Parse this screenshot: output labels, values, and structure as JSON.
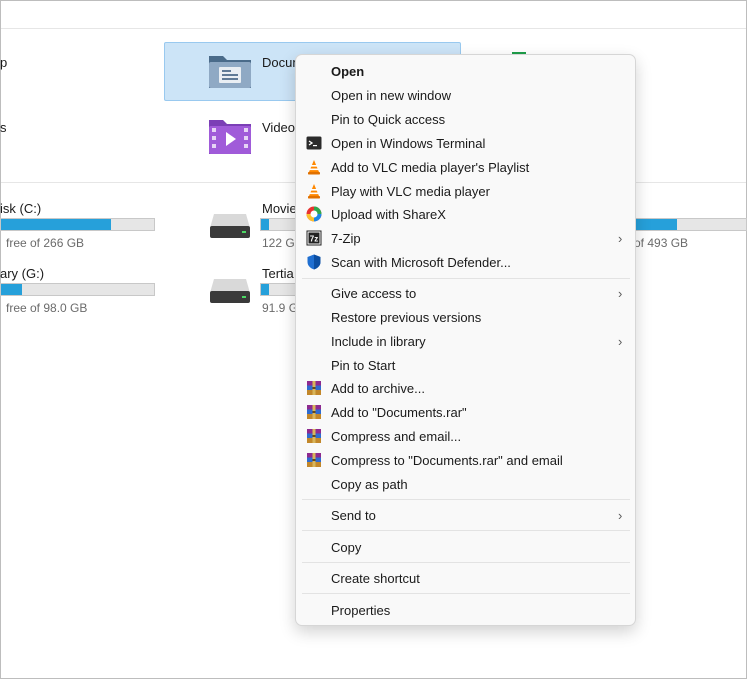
{
  "background_items": {
    "row1": {
      "left_label_fragment": "p",
      "selected_folder_label": "Docum"
    },
    "row2": {
      "left_label_fragment": "s",
      "videos_label": "Video"
    },
    "drives": [
      {
        "name_fragment": "isk (C:)",
        "free_text": "free of 266 GB",
        "used_fraction": 0.72
      },
      {
        "name_fragment": "Movie",
        "free_text": "122 G",
        "used_fraction": 0.2
      },
      {
        "name_fragment": "",
        "free_text": "of 493 GB",
        "used_fraction": 0.45
      },
      {
        "name_fragment": "ary (G:)",
        "free_text": "free of 98.0 GB",
        "used_fraction": 0.14
      },
      {
        "name_fragment": "Tertia",
        "free_text": "91.9 G",
        "used_fraction": 0.2
      }
    ]
  },
  "context_menu": {
    "items": [
      {
        "label": "Open",
        "icon": "",
        "bold": true
      },
      {
        "label": "Open in new window",
        "icon": ""
      },
      {
        "label": "Pin to Quick access",
        "icon": ""
      },
      {
        "label": "Open in Windows Terminal",
        "icon": "terminal-icon"
      },
      {
        "label": "Add to VLC media player's Playlist",
        "icon": "vlc-icon"
      },
      {
        "label": "Play with VLC media player",
        "icon": "vlc-icon"
      },
      {
        "label": "Upload with ShareX",
        "icon": "sharex-icon"
      },
      {
        "label": "7-Zip",
        "icon": "7zip-icon",
        "submenu": true
      },
      {
        "label": "Scan with Microsoft Defender...",
        "icon": "defender-shield-icon"
      },
      {
        "label": "Give access to",
        "icon": "",
        "submenu": true
      },
      {
        "label": "Restore previous versions",
        "icon": ""
      },
      {
        "label": "Include in library",
        "icon": "",
        "submenu": true
      },
      {
        "label": "Pin to Start",
        "icon": ""
      },
      {
        "label": "Add to archive...",
        "icon": "winrar-icon"
      },
      {
        "label": "Add to \"Documents.rar\"",
        "icon": "winrar-icon"
      },
      {
        "label": "Compress and email...",
        "icon": "winrar-icon"
      },
      {
        "label": "Compress to \"Documents.rar\" and email",
        "icon": "winrar-icon"
      },
      {
        "label": "Copy as path",
        "icon": ""
      },
      {
        "label": "Send to",
        "icon": "",
        "submenu": true
      },
      {
        "label": "Copy",
        "icon": ""
      },
      {
        "label": "Create shortcut",
        "icon": ""
      },
      {
        "label": "Properties",
        "icon": ""
      }
    ],
    "chevron": "›"
  },
  "colors": {
    "selection_bg": "#cce4f7",
    "drive_bar_fill": "#26a0da",
    "vlc_orange": "#ff8800",
    "defender_blue": "#1f6fd1"
  }
}
